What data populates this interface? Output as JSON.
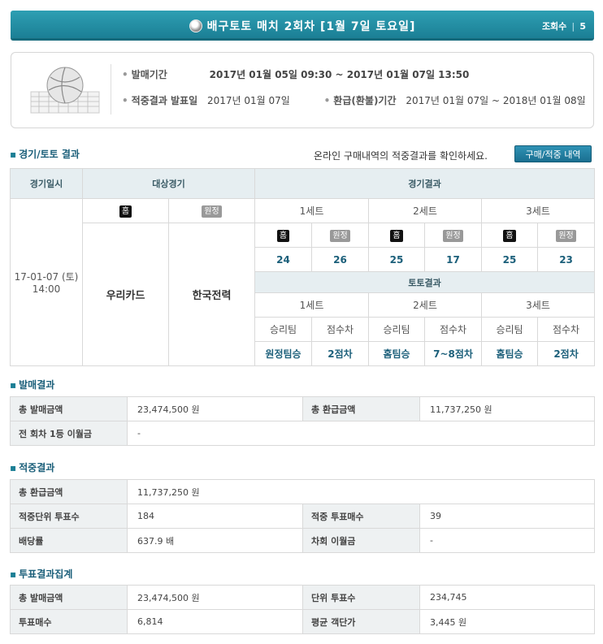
{
  "header": {
    "title": "배구토토 매치 2회차 [1월 7일 토요일]",
    "views_label": "조회수",
    "views": "5"
  },
  "info": {
    "sale_period_label": "발매기간",
    "sale_period": "2017년 01월 05일 09:30 ~ 2017년 01월 07일 13:50",
    "result_date_label": "적중결과 발표일",
    "result_date": "2017년 01월 07일",
    "refund_label": "환급(환불)기간",
    "refund_period": "2017년 01월 07일 ~ 2018년 01월 08일"
  },
  "game_section": {
    "title": "경기/토토 결과",
    "notice": "온라인 구매내역의 적중결과를 확인하세요.",
    "buy_button": "구매/적중 내역",
    "col_date": "경기일시",
    "col_match": "대상경기",
    "col_result": "경기결과",
    "home_tag": "홈",
    "away_tag": "원정",
    "date": "17-01-07 (토)",
    "time": "14:00",
    "home_team": "우리카드",
    "away_team": "한국전력",
    "sets": [
      "1세트",
      "2세트",
      "3세트"
    ],
    "scores": [
      [
        "24",
        "26"
      ],
      [
        "25",
        "17"
      ],
      [
        "25",
        "23"
      ]
    ],
    "toto_title": "토토결과",
    "toto_cols": [
      "승리팀",
      "점수차"
    ],
    "toto": [
      [
        "원정팀승",
        "2점차"
      ],
      [
        "홈팀승",
        "7~8점차"
      ],
      [
        "홈팀승",
        "2점차"
      ]
    ]
  },
  "sales": {
    "title": "발매결과",
    "total_sales_label": "총 발매금액",
    "total_sales": "23,474,500 원",
    "total_refund_label": "총 환급금액",
    "total_refund": "11,737,250 원",
    "carry_label": "전 회차 1등 이월금",
    "carry": "-"
  },
  "hits": {
    "title": "적중결과",
    "total_refund_label": "총 환급금액",
    "total_refund": "11,737,250 원",
    "hit_units_label": "적중단위 투표수",
    "hit_units": "184",
    "hit_votes_label": "적중 투표매수",
    "hit_votes": "39",
    "odds_label": "배당률",
    "odds": "637.9 배",
    "next_carry_label": "차회 이월금",
    "next_carry": "-"
  },
  "votes": {
    "title": "투표결과집계",
    "total_sales_label": "총 발매금액",
    "total_sales": "23,474,500 원",
    "unit_votes_label": "단위 투표수",
    "unit_votes": "234,745",
    "vote_count_label": "투표매수",
    "vote_count": "6,814",
    "avg_price_label": "평균 객단가",
    "avg_price": "3,445 원"
  }
}
